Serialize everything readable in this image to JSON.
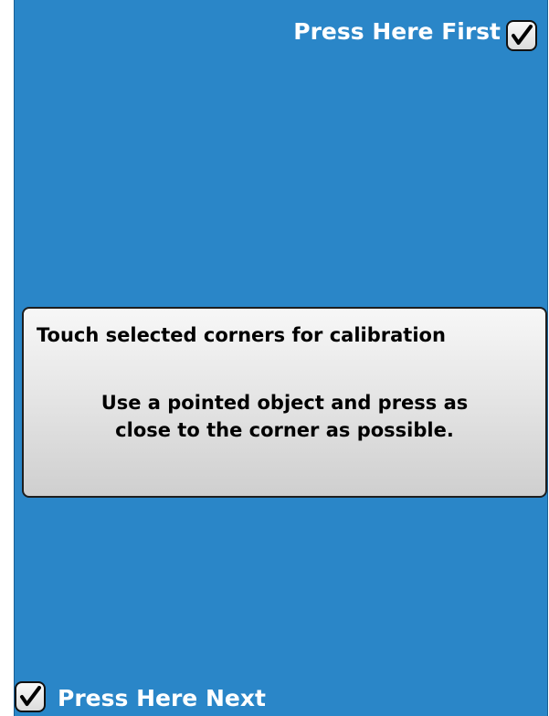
{
  "corners": {
    "first_label": "Press Here First",
    "next_label": "Press Here Next"
  },
  "dialog": {
    "title": "Touch selected corners for calibration",
    "body_line1": "Use a pointed object and press as",
    "body_line2": "close to the corner as possible."
  },
  "icons": {
    "first_checkbox": "checkmark-icon",
    "next_checkbox": "checkmark-icon"
  },
  "colors": {
    "background": "#2a86c8",
    "label_text": "#ffffff",
    "dialog_text": "#000000"
  }
}
